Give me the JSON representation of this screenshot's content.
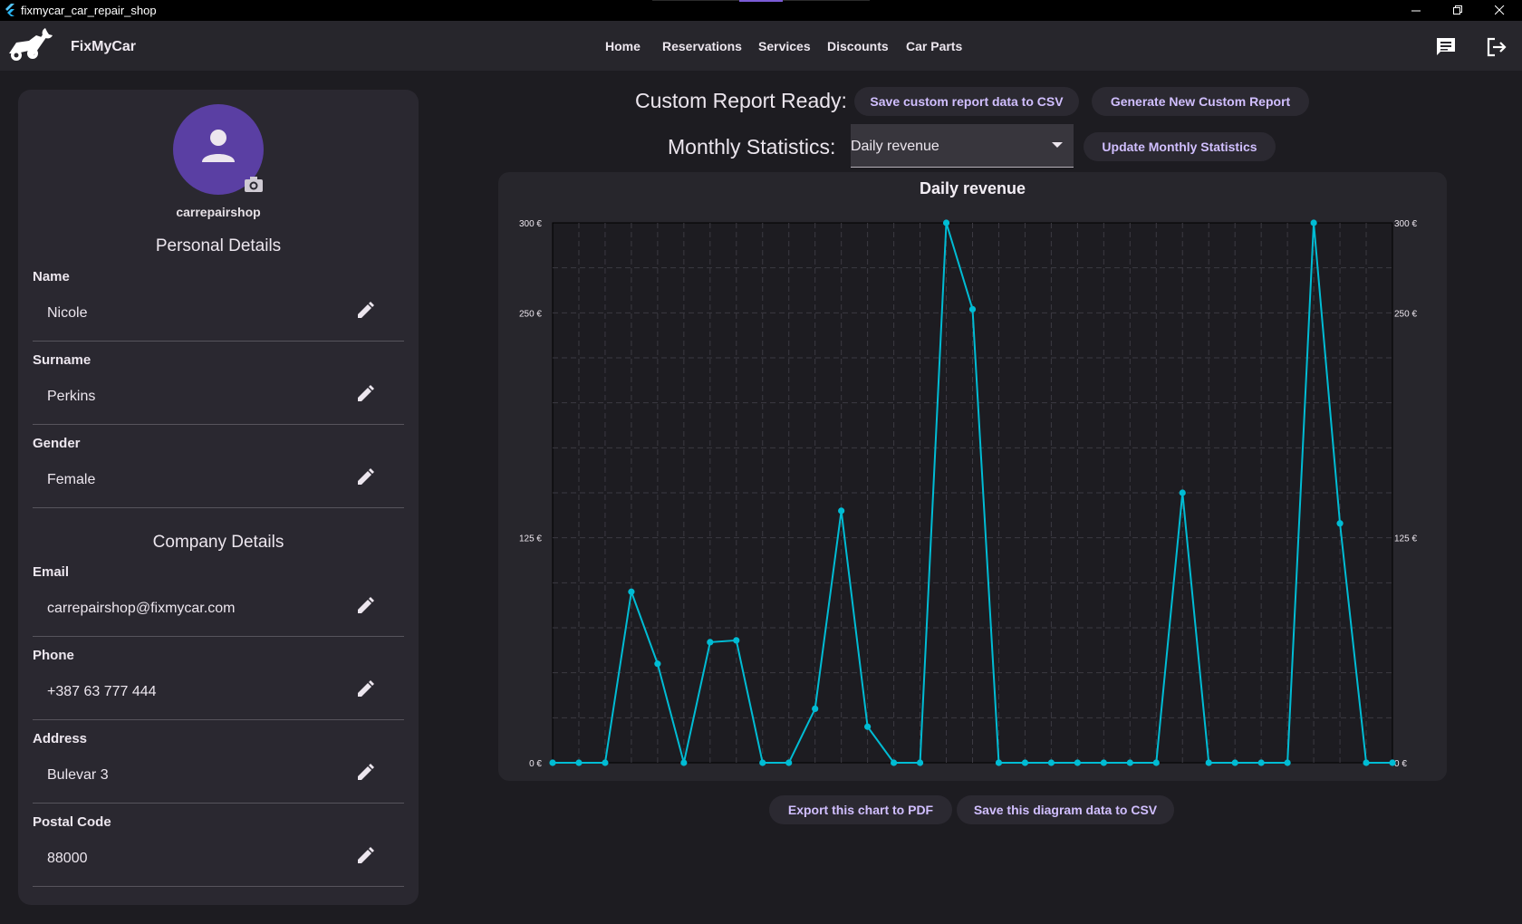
{
  "window": {
    "title": "fixmycar_car_repair_shop"
  },
  "appbar": {
    "brand": "FixMyCar",
    "nav": [
      "Home",
      "Reservations",
      "Services",
      "Discounts",
      "Car Parts"
    ]
  },
  "profile": {
    "username": "carrepairshop",
    "personal_title": "Personal Details",
    "company_title": "Company Details",
    "fields": [
      {
        "label": "Name",
        "value": "Nicole"
      },
      {
        "label": "Surname",
        "value": "Perkins"
      },
      {
        "label": "Gender",
        "value": "Female"
      },
      {
        "label": "Email",
        "value": "carrepairshop@fixmycar.com"
      },
      {
        "label": "Phone",
        "value": "+387 63 777 444"
      },
      {
        "label": "Address",
        "value": "Bulevar 3"
      },
      {
        "label": "Postal Code",
        "value": "88000"
      }
    ]
  },
  "report": {
    "custom_label": "Custom Report Ready:",
    "save_csv_button": "Save custom report data to CSV",
    "generate_button": "Generate New Custom Report",
    "monthly_label": "Monthly Statistics:",
    "monthly_selected": "Daily revenue",
    "update_button": "Update Monthly Statistics",
    "export_pdf_button": "Export this chart to PDF",
    "save_diagram_button": "Save this diagram data to CSV"
  },
  "colors": {
    "accent": "#00bcd4",
    "avatar": "#5a3fa3",
    "button_text": "#d1bfff"
  },
  "chart_data": {
    "type": "line",
    "title": "Daily revenue",
    "x": [
      1,
      2,
      3,
      4,
      5,
      6,
      7,
      8,
      9,
      10,
      11,
      12,
      13,
      14,
      15,
      16,
      17,
      18,
      19,
      20,
      21,
      22,
      23,
      24,
      25,
      26,
      27,
      28,
      29,
      30,
      31,
      32
    ],
    "values": [
      0,
      0,
      0,
      95,
      55,
      0,
      67,
      68,
      0,
      0,
      30,
      140,
      20,
      0,
      0,
      300,
      252,
      0,
      0,
      0,
      0,
      0,
      0,
      0,
      150,
      0,
      0,
      0,
      0,
      300,
      133,
      0,
      0
    ],
    "ylim": [
      0,
      300
    ],
    "y_ticks": [
      "0 €",
      "125 €",
      "250 €",
      "300 €"
    ],
    "y_tick_values": [
      0,
      125,
      250,
      300
    ],
    "grid": true,
    "series_color": "#00bcd4"
  }
}
